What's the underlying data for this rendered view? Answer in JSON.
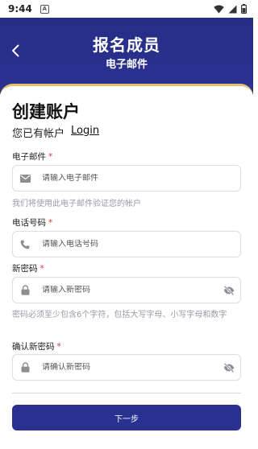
{
  "status_bar": {
    "time": "9:44",
    "app_indicator": "A",
    "icons": [
      "wifi-icon",
      "signal-icon",
      "battery-icon"
    ]
  },
  "header": {
    "title": "报名成员",
    "subtitle": "电子邮件",
    "back_icon": "chevron-left-icon"
  },
  "form": {
    "title": "创建账户",
    "have_account_text": "您已有帐户",
    "login_link": "Login",
    "email": {
      "label": "电子邮件",
      "required_mark": "*",
      "placeholder": "请输入电子邮件",
      "icon": "mail-icon",
      "hint": "我们将使用此电子邮件验证您的帐户"
    },
    "phone": {
      "label": "电话号码",
      "required_mark": "*",
      "placeholder": "请输入电话号码",
      "icon": "phone-icon"
    },
    "new_password": {
      "label": "新密码",
      "required_mark": "*",
      "placeholder": "请输入新密码",
      "icon": "lock-icon",
      "toggle_icon": "eye-off-icon",
      "hint": "密码必须至少包含6个字符，包括大写字母、小写字母和数字"
    },
    "confirm_password": {
      "label": "确认新密码",
      "required_mark": "*",
      "placeholder": "请确认新密码",
      "icon": "lock-icon",
      "toggle_icon": "eye-off-icon"
    },
    "next_button": "下一步"
  },
  "colors": {
    "brand": "#283090",
    "accent_border": "#e2c06f",
    "required": "#d83a3a"
  }
}
